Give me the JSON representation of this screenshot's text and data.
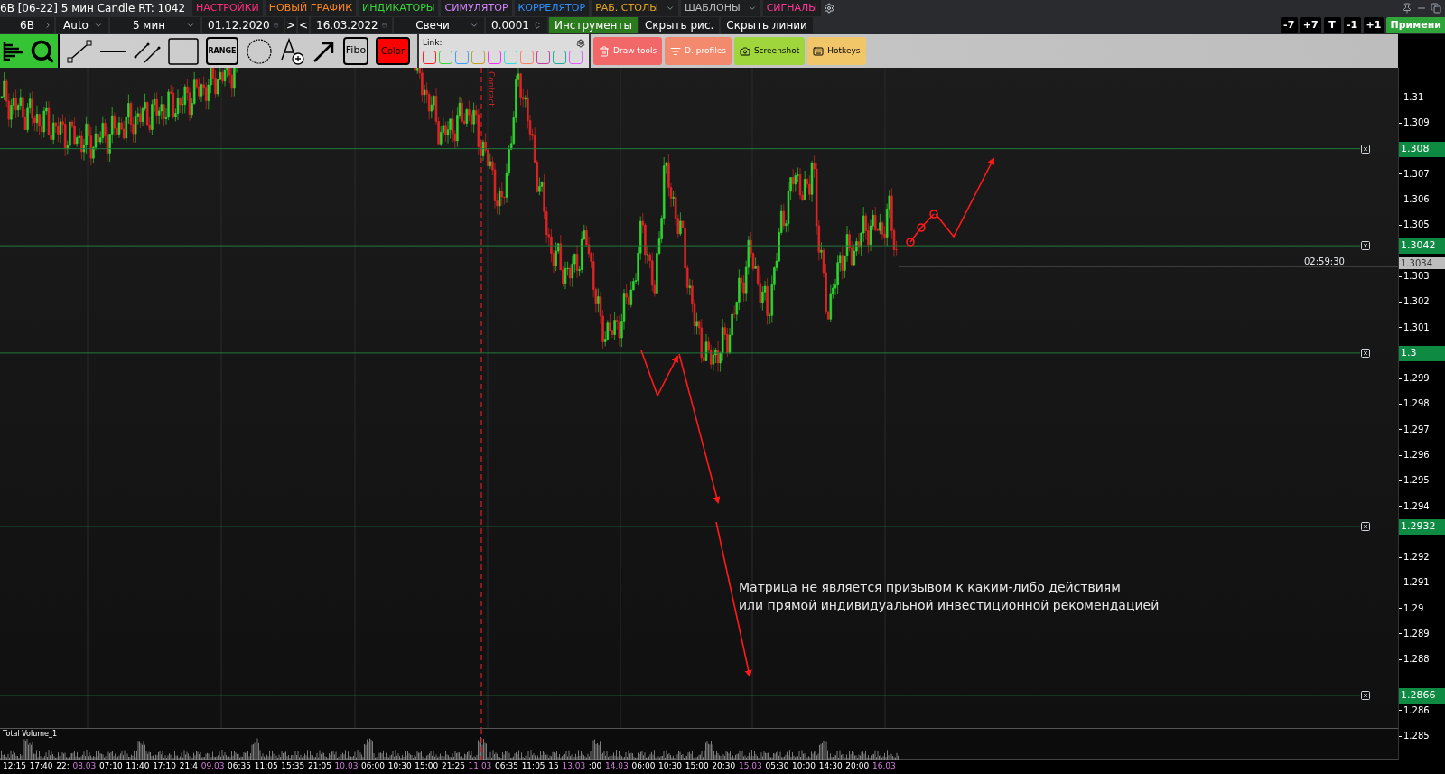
{
  "title_bar": {
    "title": "6B [06-22] 5 мин Candle RT: 1042",
    "menu": [
      {
        "label": "НАСТРОЙКИ",
        "color": "#ff2f7d",
        "has_menu": false
      },
      {
        "label": "НОВЫЙ ГРАФИК",
        "color": "#ff8a1e",
        "has_menu": false
      },
      {
        "label": "ИНДИКАТОРЫ",
        "color": "#3ad63a",
        "has_menu": false
      },
      {
        "label": "СИМУЛЯТОР",
        "color": "#d586ff",
        "has_menu": false
      },
      {
        "label": "КОРРЕЛЯТОР",
        "color": "#2f90ff",
        "has_menu": false
      },
      {
        "label": "РАБ. СТОЛЫ",
        "color": "#e6a520",
        "has_menu": true
      },
      {
        "label": "ШАБЛОНЫ",
        "color": "#bdbdbd",
        "has_menu": true
      },
      {
        "label": "СИГНАЛЫ",
        "color": "#ff3a96",
        "has_menu": false
      }
    ]
  },
  "settings_bar": {
    "fields": [
      {
        "kind": "symbol",
        "value": "6B"
      },
      {
        "kind": "select",
        "value": "Auto"
      },
      {
        "kind": "select",
        "value": "5 мин"
      },
      {
        "kind": "date",
        "value": "01.12.2020"
      },
      {
        "kind": "step",
        "value": ">"
      },
      {
        "kind": "step",
        "value": "<"
      },
      {
        "kind": "date",
        "value": "16.03.2022"
      },
      {
        "kind": "select",
        "value": "Свечи"
      },
      {
        "kind": "spin",
        "value": "0.0001"
      },
      {
        "kind": "accent",
        "value": "Инструменты"
      },
      {
        "kind": "button",
        "value": "Скрыть рис."
      },
      {
        "kind": "button",
        "value": "Скрыть линии"
      }
    ],
    "shift_buttons": [
      "-7",
      "+7",
      "T",
      "-1",
      "+1"
    ],
    "apply_button": "Примени"
  },
  "toolbar": {
    "range_button": "RANGE",
    "fibo_button": "Fibo",
    "color_button": {
      "label": "Color",
      "color": "#ff0000"
    },
    "link": {
      "label": "Link:",
      "slots": [
        {
          "color": "#ff2020"
        },
        {
          "color": "#3ad63a"
        },
        {
          "color": "#3aa0ff"
        },
        {
          "color": "#c8a020"
        },
        {
          "color": "#ff30ff"
        },
        {
          "color": "#30e0e0"
        },
        {
          "color": "#ff8060"
        },
        {
          "color": "#c040a0"
        },
        {
          "color": "#20b0a0"
        },
        {
          "color": "#e060ff"
        }
      ]
    },
    "actions": [
      {
        "kind": "trash",
        "label": "Draw tools",
        "color": "#f26868"
      },
      {
        "kind": "profiles",
        "label": "D. profiles",
        "color": "#f38a6e"
      },
      {
        "kind": "camera",
        "label": "Screenshot",
        "color": "#9fd63c"
      },
      {
        "kind": "keyboard",
        "label": "Hotkeys",
        "color": "#f0c668"
      }
    ]
  },
  "chart": {
    "contract_label": "Contract",
    "levels": [
      "1.308",
      "1.3042",
      "1.3",
      "1.2932",
      "1.2866"
    ],
    "current_price": "1.3034",
    "countdown": "02:59:30",
    "note": "Матрица не является призывом к каким-либо действиям\nили прямой индивидуальной инвестиционной рекомендацией",
    "volume_label": "Total Volume_1",
    "price_ticks": [
      "1.31",
      "1.309",
      "1.307",
      "1.306",
      "1.305",
      "1.303",
      "1.302",
      "1.301",
      "1.299",
      "1.298",
      "1.297",
      "1.296",
      "1.295",
      "1.294",
      "1.292",
      "1.291",
      "1.29",
      "1.289",
      "1.288",
      "1.286",
      "1.285"
    ],
    "time_labels": [
      {
        "kind": "time",
        "text": "12:15"
      },
      {
        "kind": "time",
        "text": "17:40"
      },
      {
        "kind": "time",
        "text": "22:"
      },
      {
        "kind": "date",
        "text": "08.03"
      },
      {
        "kind": "time",
        "text": "07:10"
      },
      {
        "kind": "time",
        "text": "11:40"
      },
      {
        "kind": "time",
        "text": "17:10"
      },
      {
        "kind": "time",
        "text": "21:4"
      },
      {
        "kind": "date",
        "text": "09.03"
      },
      {
        "kind": "time",
        "text": "06:35"
      },
      {
        "kind": "time",
        "text": "11:05"
      },
      {
        "kind": "time",
        "text": "15:35"
      },
      {
        "kind": "time",
        "text": "21:05"
      },
      {
        "kind": "date",
        "text": "10.03"
      },
      {
        "kind": "time",
        "text": "06:00"
      },
      {
        "kind": "time",
        "text": "10:30"
      },
      {
        "kind": "time",
        "text": "15:00"
      },
      {
        "kind": "time",
        "text": "21:25"
      },
      {
        "kind": "date",
        "text": "11.03"
      },
      {
        "kind": "time",
        "text": "06:35"
      },
      {
        "kind": "time",
        "text": "11:05"
      },
      {
        "kind": "time",
        "text": "15"
      },
      {
        "kind": "date",
        "text": "13.03"
      },
      {
        "kind": "time",
        "text": ":00"
      },
      {
        "kind": "date",
        "text": "14.03"
      },
      {
        "kind": "time",
        "text": "06:00"
      },
      {
        "kind": "time",
        "text": "10:30"
      },
      {
        "kind": "time",
        "text": "15:00"
      },
      {
        "kind": "time",
        "text": "20:30"
      },
      {
        "kind": "date",
        "text": "15.03"
      },
      {
        "kind": "time",
        "text": "05:30"
      },
      {
        "kind": "time",
        "text": "10:00"
      },
      {
        "kind": "time",
        "text": "14:30"
      },
      {
        "kind": "time",
        "text": "20:00"
      },
      {
        "kind": "date",
        "text": "16.03"
      }
    ]
  }
}
